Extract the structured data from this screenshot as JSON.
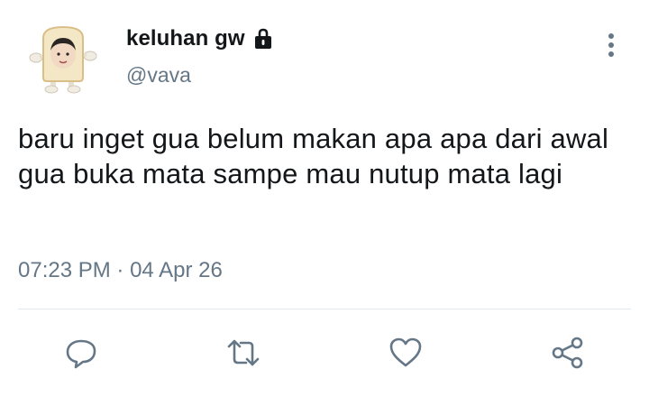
{
  "user": {
    "display_name": "keluhan gw",
    "handle": "@vava",
    "protected": true
  },
  "tweet": {
    "text": "baru inget gua belum makan apa apa dari awal gua buka mata sampe mau nutup mata lagi",
    "time": "07:23 PM",
    "separator": "·",
    "date": "04 Apr 26"
  },
  "icons": {
    "lock": "lock-icon",
    "more": "more-vertical-icon",
    "reply": "reply-icon",
    "retweet": "retweet-icon",
    "like": "heart-icon",
    "share": "share-icon"
  },
  "colors": {
    "text": "#14171a",
    "secondary": "#657786",
    "accent": "#1da1f2",
    "divider": "#e1e8ed"
  }
}
